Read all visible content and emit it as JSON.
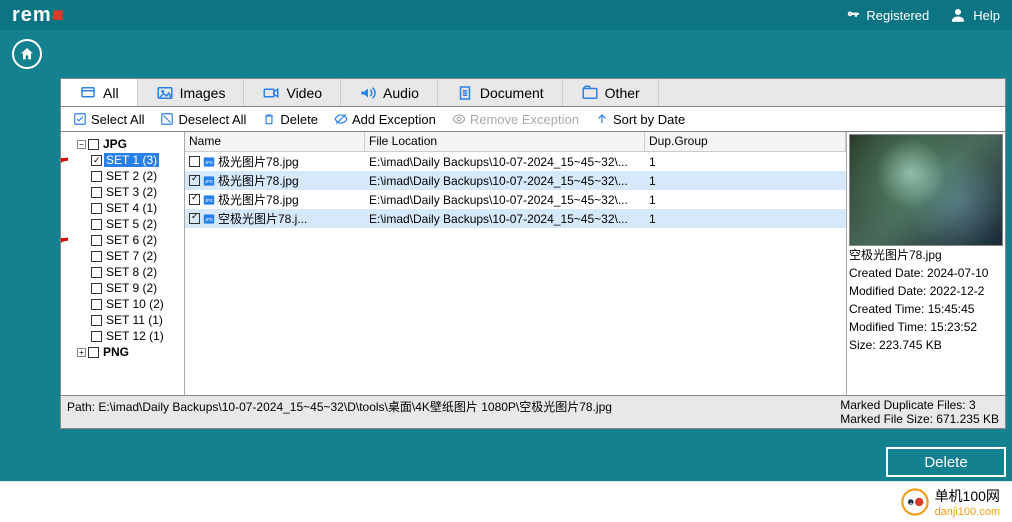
{
  "brand": {
    "text_left": "rem",
    "text_right": "o"
  },
  "top": {
    "registered": "Registered",
    "help": "Help"
  },
  "tabs": [
    {
      "label": "All",
      "active": true
    },
    {
      "label": "Images"
    },
    {
      "label": "Video"
    },
    {
      "label": "Audio"
    },
    {
      "label": "Document"
    },
    {
      "label": "Other"
    }
  ],
  "toolbar": {
    "select_all": "Select All",
    "deselect_all": "Deselect All",
    "delete": "Delete",
    "add_exception": "Add Exception",
    "remove_exception": "Remove Exception",
    "sort_by_date": "Sort by Date"
  },
  "tree": {
    "root": "JPG",
    "sets": [
      {
        "label": "SET 1 (3)",
        "checked": true,
        "selected": true,
        "arrow": true
      },
      {
        "label": "SET 2 (2)"
      },
      {
        "label": "SET 3 (2)"
      },
      {
        "label": "SET 4 (1)"
      },
      {
        "label": "SET 5 (2)"
      },
      {
        "label": "SET 6 (2)",
        "arrow": true
      },
      {
        "label": "SET 7 (2)"
      },
      {
        "label": "SET 8 (2)"
      },
      {
        "label": "SET 9 (2)"
      },
      {
        "label": "SET 10 (2)"
      },
      {
        "label": "SET 11 (1)"
      },
      {
        "label": "SET 12 (1)"
      }
    ],
    "next": "PNG"
  },
  "columns": {
    "name": "Name",
    "file_location": "File Location",
    "dup": "Dup.Group"
  },
  "rows": [
    {
      "checked": false,
      "name": "极光图片78.jpg",
      "loc": "E:\\imad\\Daily Backups\\10-07-2024_15~45~32\\...",
      "grp": "1",
      "sel": false
    },
    {
      "checked": true,
      "name": "极光图片78.jpg",
      "loc": "E:\\imad\\Daily Backups\\10-07-2024_15~45~32\\...",
      "grp": "1",
      "sel": true
    },
    {
      "checked": true,
      "name": "极光图片78.jpg",
      "loc": "E:\\imad\\Daily Backups\\10-07-2024_15~45~32\\...",
      "grp": "1",
      "sel": false
    },
    {
      "checked": true,
      "name": "空极光图片78.j...",
      "loc": "E:\\imad\\Daily Backups\\10-07-2024_15~45~32\\...",
      "grp": "1",
      "sel": true
    }
  ],
  "preview": {
    "filename": "空极光图片78.jpg",
    "created_date_lbl": "Created Date: ",
    "created_date": "2024-07-10",
    "modified_date_lbl": "Modified Date: ",
    "modified_date": "2022-12-2",
    "created_time_lbl": "Created Time: ",
    "created_time": "15:45:45",
    "modified_time_lbl": "Modified Time: ",
    "modified_time": "15:23:52",
    "size_lbl": "Size: ",
    "size": "223.745 KB"
  },
  "status": {
    "path_lbl": "Path:  ",
    "path": "E:\\imad\\Daily Backups\\10-07-2024_15~45~32\\D\\tools\\桌面\\4K壁纸图片 1080P\\空极光图片78.jpg",
    "marked_files_lbl": "Marked Duplicate Files: ",
    "marked_files": "3",
    "marked_size_lbl": "Marked File Size: ",
    "marked_size": "671.235 KB"
  },
  "delete_btn": "Delete",
  "footer": {
    "cn": "单机100网",
    "url": "danji100.com"
  }
}
